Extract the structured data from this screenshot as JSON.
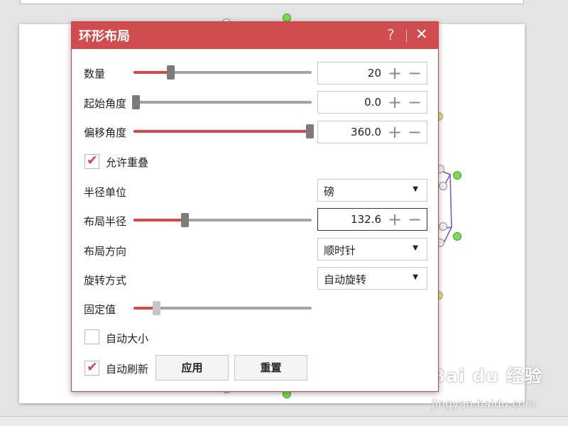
{
  "dialog": {
    "title": "环形布局",
    "help_glyph": "?",
    "close_glyph": "✕"
  },
  "rows": {
    "count": {
      "label": "数量",
      "value": "20",
      "slider_fraction": 0.2
    },
    "start_angle": {
      "label": "起始角度",
      "value": "0.0",
      "slider_fraction": 0.0
    },
    "offset_angle": {
      "label": "偏移角度",
      "value": "360.0",
      "slider_fraction": 1.0
    },
    "allow_overlap": {
      "label": "允许重叠",
      "checked": true
    },
    "radius_unit": {
      "label": "半径单位",
      "value": "磅"
    },
    "layout_radius": {
      "label": "布局半径",
      "value": "132.6",
      "slider_fraction": 0.28
    },
    "layout_direction": {
      "label": "布局方向",
      "value": "顺时针"
    },
    "rotation_mode": {
      "label": "旋转方式",
      "value": "自动旋转"
    },
    "fixed_value": {
      "label": "固定值",
      "slider_fraction": 0.12
    },
    "auto_size": {
      "label": "自动大小",
      "checked": false
    },
    "auto_refresh": {
      "label": "自动刷新",
      "checked": true
    }
  },
  "buttons": {
    "apply": "应用",
    "reset": "重置"
  },
  "glyphs": {
    "plus": "+",
    "minus": "−",
    "dropdown": "▼",
    "check": "✔"
  },
  "watermark": {
    "logo": "Bai du 经验",
    "url": "jingyan.baidu.com"
  },
  "colors": {
    "accent": "#cf4c4f",
    "slider_fill": "#d0494d",
    "track": "#a3a3a3"
  }
}
